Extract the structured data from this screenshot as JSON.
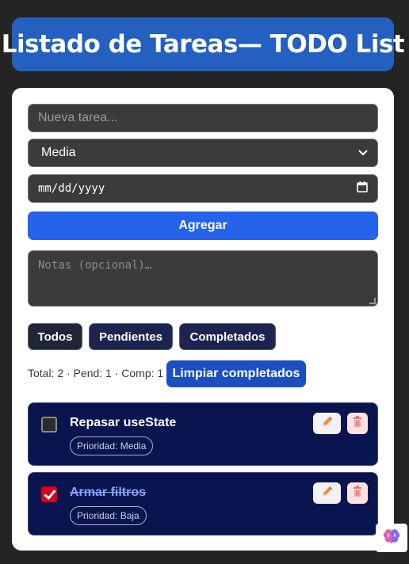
{
  "header": {
    "title": "Listado de Tareas— TODO List"
  },
  "form": {
    "task_placeholder": "Nueva tarea...",
    "priority_selected": "Media",
    "date_placeholder": "mm/dd/yyyy",
    "add_label": "Agregar",
    "notes_placeholder": "Notas (opcional)…"
  },
  "filters": {
    "all": "Todos",
    "pending": "Pendientes",
    "completed": "Completados"
  },
  "stats": {
    "text": "Total: 2 · Pend: 1 · Comp: 1"
  },
  "clear_label": "Limpiar completados",
  "tasks": [
    {
      "title": "Repasar useState",
      "priority": "Prioridad: Media",
      "completed": false
    },
    {
      "title": "Armar filtros",
      "priority": "Prioridad: Baja",
      "completed": true
    }
  ],
  "colors": {
    "accent": "#2563eb",
    "header_bg": "#2360c0",
    "task_bg": "#0a1550",
    "checkbox_checked": "#d4001f"
  },
  "icons": {
    "edit": "pencil-icon",
    "delete": "trash-icon",
    "calendar": "calendar-icon",
    "floating": "brain-icon"
  }
}
